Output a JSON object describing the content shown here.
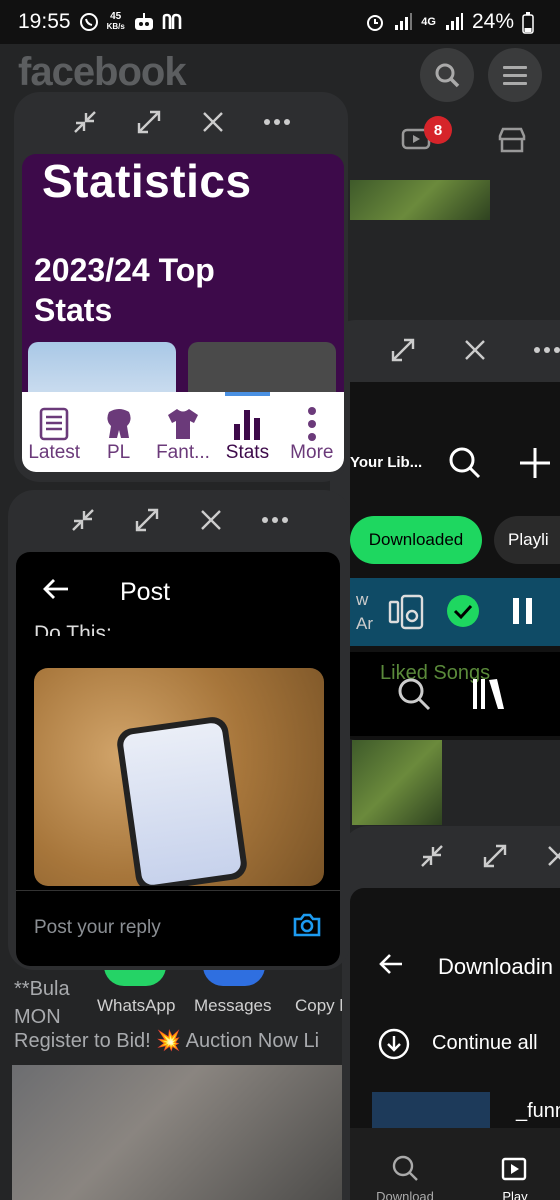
{
  "status_bar": {
    "time": "19:55",
    "net_speed_value": "45",
    "net_speed_unit": "KB/s",
    "network_type": "4G",
    "battery": "24%"
  },
  "facebook": {
    "logo": "facebook",
    "notification_count": "8",
    "post_text_line1": "**Bula",
    "post_text_line2": "MON",
    "post_text_line3": "Register to Bid! 💥 Auction Now Li",
    "share_whatsapp": "WhatsApp",
    "share_messages": "Messages",
    "share_copy": "Copy li",
    "colors": {
      "background": "#242526",
      "logo": "#5c5e60",
      "badge": "#d6242a"
    }
  },
  "premier_league_window": {
    "title": "Statistics",
    "subtitle_line1": "2023/24 Top",
    "subtitle_line2": "Stats",
    "nav": [
      {
        "label": "Latest",
        "icon": "news-icon"
      },
      {
        "label": "PL",
        "icon": "lion-icon"
      },
      {
        "label": "Fant...",
        "icon": "shirt-icon"
      },
      {
        "label": "Stats",
        "icon": "bar-chart-icon",
        "active": true
      },
      {
        "label": "More",
        "icon": "more-vertical-icon"
      }
    ],
    "colors": {
      "header": "#3d0a4a",
      "active_indicator": "#4a90e2"
    }
  },
  "x_post_window": {
    "header_title": "Post",
    "cut_text": "Do This:",
    "reply_placeholder": "Post your reply"
  },
  "spotify_window": {
    "library_label": "Your Lib...",
    "filter_downloaded": "Downloaded",
    "filter_playlists": "Playli",
    "now_playing_prefix": "w",
    "now_playing_artist": "Ar",
    "liked_songs": "Liked Songs",
    "colors": {
      "pill_active": "#1ed760",
      "now_playing": "#0f4b66"
    }
  },
  "downloads_window": {
    "title": "Downloadin",
    "continue_all": "Continue all",
    "item_name": "_funn",
    "nav": [
      {
        "label": "Download",
        "icon": "search-icon"
      },
      {
        "label": "Play",
        "icon": "play-icon",
        "active": true
      }
    ]
  }
}
